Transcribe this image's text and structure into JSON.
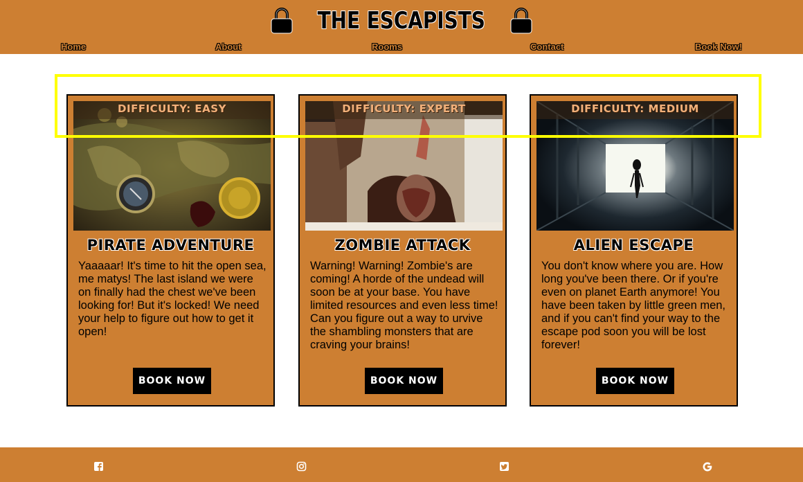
{
  "header": {
    "title": "THE ESCAPISTS",
    "nav": [
      "Home",
      "About",
      "Rooms",
      "Contact",
      "Book Now!"
    ]
  },
  "rooms": [
    {
      "difficulty": "DIFFICULTY: EASY",
      "title": "PIRATE ADVENTURE",
      "description": "Yaaaaar! It's time to hit the open sea, me matys! The last island we were on finally had the chest we've been looking for! But it's locked! We need your help to figure out how to get it open!",
      "button": "BOOK NOW"
    },
    {
      "difficulty": "DIFFICULTY: EXPERT",
      "title": "ZOMBIE ATTACK",
      "description": "Warning! Warning! Zombie's are coming! A horde of the undead will soon be at your base. You have limited resources and even less time! Can you figure out a way to urvive the shambling monsters that are craving your brains!",
      "button": "BOOK NOW"
    },
    {
      "difficulty": "DIFFICULTY: MEDIUM",
      "title": "ALIEN ESCAPE",
      "description": "You don't know where you are. How long you've been there. Or if you're even on planet Earth anymore! You have been taken by little green men, and if you can't find your way to the escape pod soon you will be lost forever!",
      "button": "BOOK NOW"
    }
  ],
  "footer": {
    "icons": [
      "facebook-icon",
      "instagram-icon",
      "twitter-icon",
      "google-icon"
    ]
  },
  "colors": {
    "brand": "#cd7f32",
    "highlight": "#ffff00"
  }
}
